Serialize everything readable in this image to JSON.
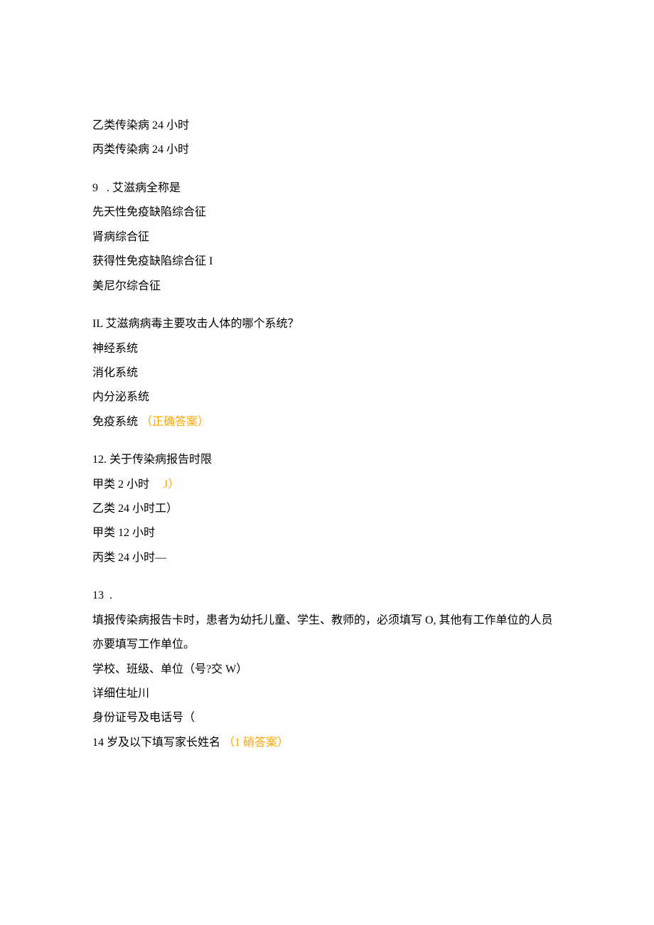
{
  "lines": {
    "l1": "乙类传染病 24 小时",
    "l2": "丙类传染病 24 小时",
    "l3": "9   . 艾滋病全称是",
    "l4": "先天性免疫缺陷综合征",
    "l5": "肾病综合征",
    "l6": "获得性免疫缺陷综合征 I",
    "l7": "美尼尔综合征",
    "l8": "IL 艾滋病病毒主要攻击人体的哪个系统？",
    "l9": "神经系统",
    "l10": "消化系统",
    "l11": "内分泌系统",
    "l12a": "免疫系统 ",
    "l12b": "（正确答案）",
    "l13": "12. 关于传染病报告时限",
    "l14a": "甲类 2 小时     ",
    "l14b": "J）",
    "l15": "乙类 24 小时工）",
    "l16": "甲类 12 小时",
    "l17": "丙类 24 小时—",
    "l18": "13  .",
    "l19": "填报传染病报告卡时，患者为幼托儿童、学生、教师的，必须填写 O, 其他有工作单位的人员亦要填写工作单位。",
    "l20": "学校、班级、单位（号?交 W）",
    "l21": "详细住址川",
    "l22": "身份证号及电话号（",
    "l23a": "14 岁及以下填写家长姓名 ",
    "l23b": "（1 硝答案）"
  }
}
